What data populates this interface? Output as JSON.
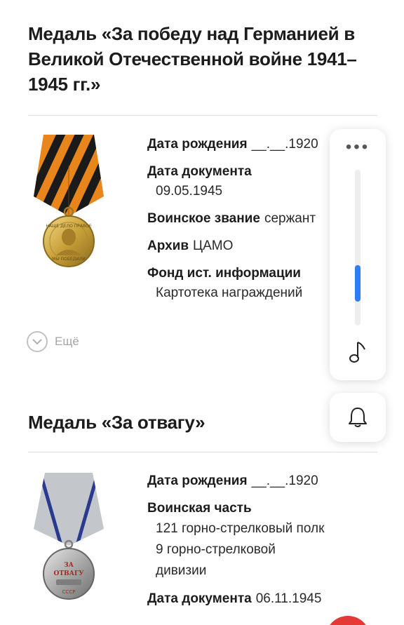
{
  "award1": {
    "title": "Медаль «За победу над Германией в Великой Отечественной войне 1941–1945 гг.»",
    "fields": [
      {
        "label": "Дата рождения",
        "value": "__.__.1920"
      },
      {
        "label": "Дата документа",
        "value": "09.05.1945"
      },
      {
        "label": "Воинское звание",
        "value": "сержант"
      },
      {
        "label": "Архив",
        "value": "ЦАМО"
      },
      {
        "label": "Фонд ист. информации",
        "value": "Картотека награждений"
      }
    ],
    "more_label": "Ещё",
    "medal_inscription": "НАШЕ ДЕЛО ПРАВОЕ МЫ ПОБЕДИЛИ"
  },
  "award2": {
    "title": "Медаль «За отвагу»",
    "fields": [
      {
        "label": "Дата рождения",
        "value": "__.__.1920"
      },
      {
        "label": "Воинская часть",
        "value_lines": [
          "121 горно-стрелковый полк",
          "9 горно-стрелковой",
          "дивизии"
        ]
      },
      {
        "label": "Дата документа",
        "value": "06.11.1945"
      }
    ],
    "medal_inscription": [
      "ЗА",
      "ОТВАГУ",
      "СССР"
    ]
  },
  "panel": {
    "menu_icon": "more-dots-icon",
    "music_icon": "music-note-icon",
    "bell_icon": "bell-icon",
    "scroll_progress": 0.8,
    "accent": "#2f7cf6"
  }
}
